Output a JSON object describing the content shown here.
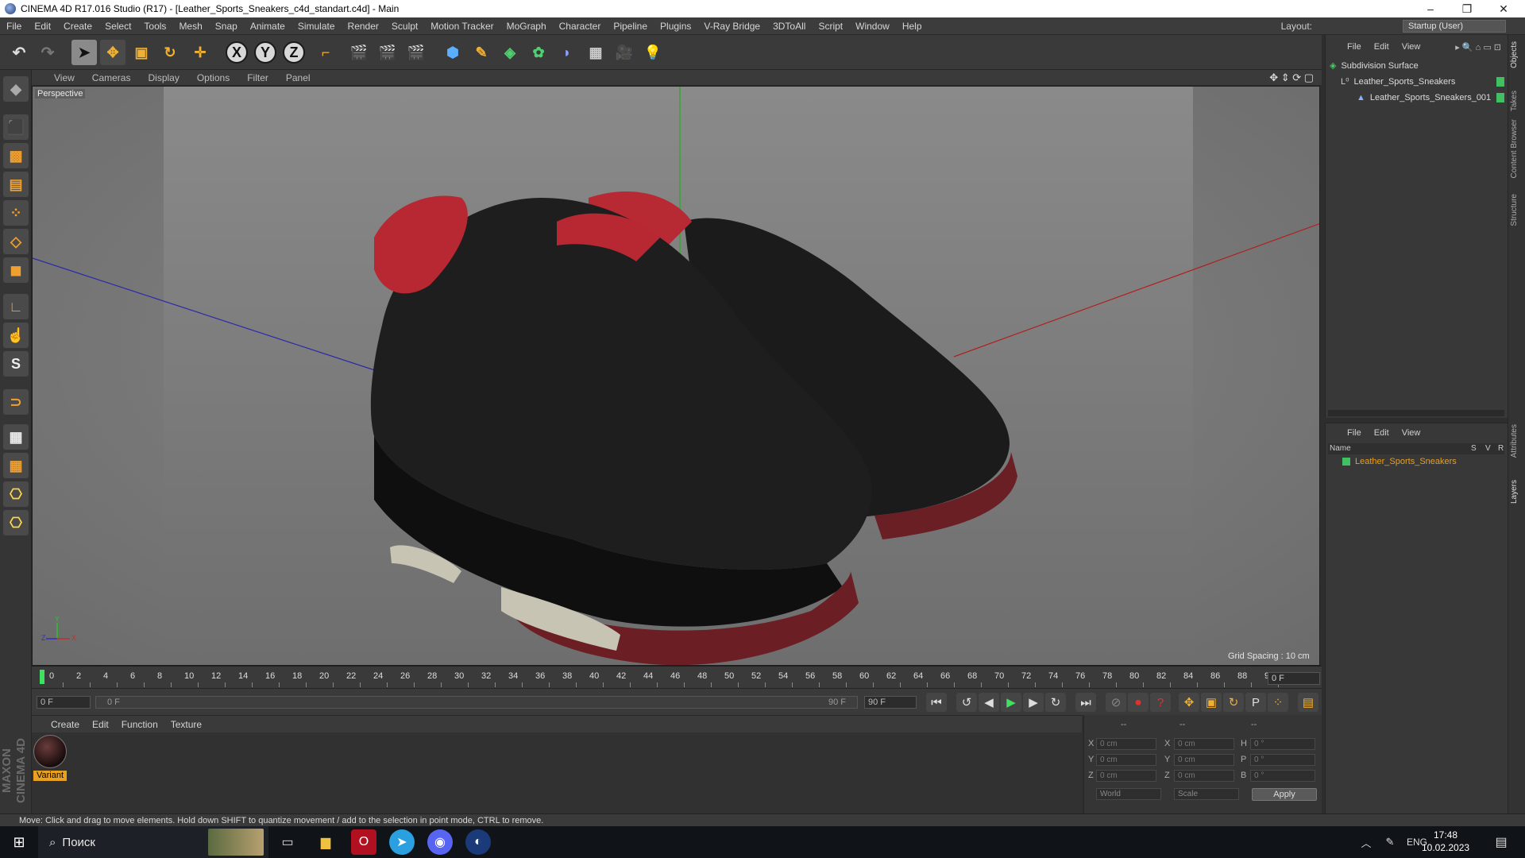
{
  "window": {
    "title": "CINEMA 4D R17.016 Studio (R17) - [Leather_Sports_Sneakers_c4d_standart.c4d] - Main",
    "controls": {
      "minimize": "–",
      "maximize": "❐",
      "close": "✕"
    }
  },
  "menubar": {
    "items": [
      "File",
      "Edit",
      "Create",
      "Select",
      "Tools",
      "Mesh",
      "Snap",
      "Animate",
      "Simulate",
      "Render",
      "Sculpt",
      "Motion Tracker",
      "MoGraph",
      "Character",
      "Pipeline",
      "Plugins",
      "V-Ray Bridge",
      "3DToAll",
      "Script",
      "Window",
      "Help"
    ],
    "layout_label": "Layout:",
    "layout_value": "Startup (User)"
  },
  "viewport": {
    "menu": [
      "View",
      "Cameras",
      "Display",
      "Options",
      "Filter",
      "Panel"
    ],
    "camera_label": "Perspective",
    "grid_spacing": "Grid Spacing : 10 cm",
    "axis_labels": {
      "y": "Y",
      "x": "X",
      "z": "Z"
    }
  },
  "timeline": {
    "ticks": [
      "0",
      "2",
      "4",
      "6",
      "8",
      "10",
      "12",
      "14",
      "16",
      "18",
      "20",
      "22",
      "24",
      "26",
      "28",
      "30",
      "32",
      "34",
      "36",
      "38",
      "40",
      "42",
      "44",
      "46",
      "48",
      "50",
      "52",
      "54",
      "56",
      "58",
      "60",
      "62",
      "64",
      "66",
      "68",
      "70",
      "72",
      "74",
      "76",
      "78",
      "80",
      "82",
      "84",
      "86",
      "88",
      "90"
    ],
    "current_frame": "0 F",
    "start_field": "0 F",
    "range_start": "0 F",
    "range_end": "90 F",
    "end_field": "90 F"
  },
  "material_manager": {
    "menu": [
      "Create",
      "Edit",
      "Function",
      "Texture"
    ],
    "materials": [
      {
        "name": "Variant"
      }
    ]
  },
  "coordinates": {
    "header": [
      "--",
      "--",
      "--"
    ],
    "rows": [
      {
        "l1": "X",
        "v1": "0 cm",
        "l2": "X",
        "v2": "0 cm",
        "l3": "H",
        "v3": "0 °"
      },
      {
        "l1": "Y",
        "v1": "0 cm",
        "l2": "Y",
        "v2": "0 cm",
        "l3": "P",
        "v3": "0 °"
      },
      {
        "l1": "Z",
        "v1": "0 cm",
        "l2": "Z",
        "v2": "0 cm",
        "l3": "B",
        "v3": "0 °"
      }
    ],
    "space": "World",
    "mode": "Scale",
    "apply": "Apply"
  },
  "object_manager": {
    "menu": [
      "File",
      "Edit",
      "View"
    ],
    "objects": [
      {
        "name": "Subdivision Surface"
      },
      {
        "name": "Leather_Sports_Sneakers"
      },
      {
        "name": "Leather_Sports_Sneakers_001"
      }
    ]
  },
  "layer_manager": {
    "menu": [
      "File",
      "Edit",
      "View"
    ],
    "columns": {
      "name": "Name",
      "s": "S",
      "v": "V",
      "r": "R"
    },
    "layers": [
      {
        "name": "Leather_Sports_Sneakers",
        "color": "#40c060"
      }
    ]
  },
  "side_tabs": [
    "Objects",
    "Takes",
    "Content Browser",
    "Structure",
    "Attributes",
    "Layers"
  ],
  "logo": "MAXON CINEMA 4D",
  "status_text": "Move: Click and drag to move elements. Hold down SHIFT to quantize movement / add to the selection in point mode, CTRL to remove.",
  "taskbar": {
    "search_placeholder": "Поиск",
    "language": "ENG",
    "time": "17:48",
    "date": "10.02.2023"
  },
  "colors": {
    "accent_orange": "#e8a020",
    "layer_green": "#40c060",
    "axis_y": "#20c020",
    "axis_x": "#c02020",
    "axis_z": "#2020c0"
  }
}
